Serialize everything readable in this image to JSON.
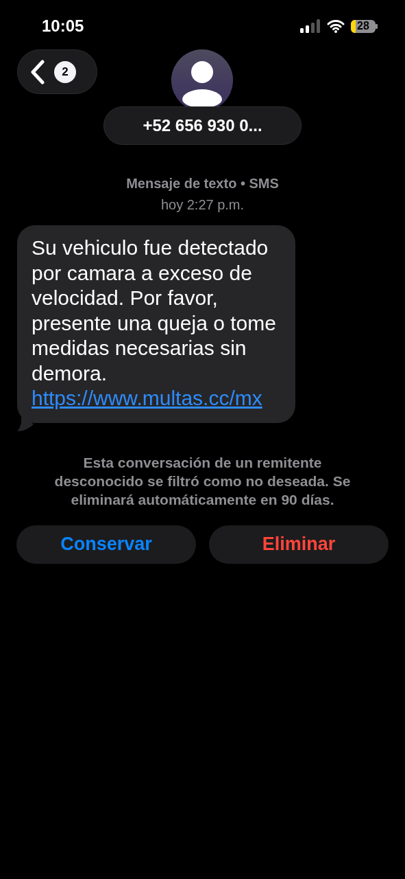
{
  "status_bar": {
    "time": "10:05",
    "battery": "28"
  },
  "header": {
    "back_badge": "2",
    "contact": "+52 656 930 0..."
  },
  "meta": {
    "service": "Mensaje de texto • SMS",
    "timestamp": "hoy 2:27 p.m."
  },
  "message": {
    "text": "Su vehiculo fue detectado por camara a exceso de velocidad. Por favor, presente una queja o tome medidas necesarias sin demora.",
    "link": "https://www.multas.cc/mx"
  },
  "notice": "Esta conversación de un remitente desconocido se filtró como no deseada. Se eliminará automáticamente en 90 días.",
  "actions": [
    {
      "label": "Conservar",
      "kind": "keep"
    },
    {
      "label": "Eliminar",
      "kind": "delete"
    }
  ]
}
